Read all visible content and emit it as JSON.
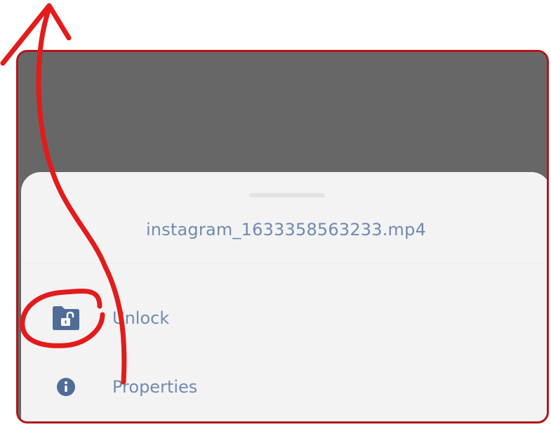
{
  "sheet": {
    "title": "instagram_1633358563233.mp4"
  },
  "menu": {
    "items": [
      {
        "label": "Unlock",
        "icon": "unlock-folder-icon"
      },
      {
        "label": "Properties",
        "icon": "info-icon"
      }
    ]
  },
  "colors": {
    "frame_border": "#b3161c",
    "backdrop": "#676767",
    "sheet_bg": "#f3f3f3",
    "text": "#6f8bb0",
    "icon": "#4f6d96",
    "annotation": "#e31b1b"
  },
  "annotation": {
    "shapes": [
      "arrow-up",
      "circle-around-unlock-icon"
    ]
  }
}
